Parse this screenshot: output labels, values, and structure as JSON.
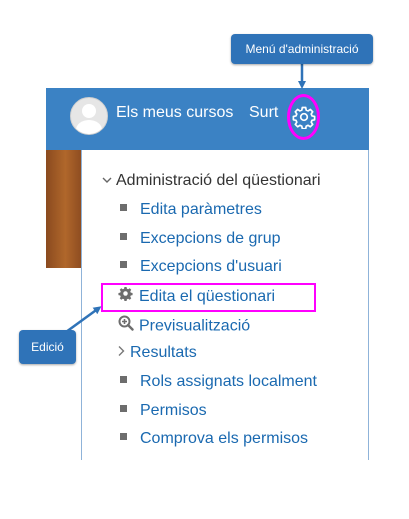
{
  "callouts": {
    "admin_menu": "Menú d'administració",
    "edit": "Edició"
  },
  "navbar": {
    "my_courses": "Els meus cursos",
    "logout": "Surt",
    "user_icon": "user-avatar-icon",
    "settings_icon": "gear-icon"
  },
  "admin_block": {
    "title": "Administració del qüestionari",
    "items": [
      {
        "label": "Edita paràmetres",
        "icon": "bullet"
      },
      {
        "label": "Excepcions de grup",
        "icon": "bullet"
      },
      {
        "label": "Excepcions d'usuari",
        "icon": "bullet"
      },
      {
        "label": "Edita el qüestionari",
        "icon": "gear-icon"
      },
      {
        "label": "Previsualització",
        "icon": "magnify-plus-icon"
      },
      {
        "label": "Resultats",
        "icon": "chevron-right-icon"
      },
      {
        "label": "Rols assignats localment",
        "icon": "bullet"
      },
      {
        "label": "Permisos",
        "icon": "bullet"
      },
      {
        "label": "Comprova els permisos",
        "icon": "bullet"
      }
    ]
  },
  "colors": {
    "navbar": "#3b82c4",
    "link": "#1a69b0",
    "highlight": "#ff00ff",
    "callout": "#2f73b8"
  }
}
